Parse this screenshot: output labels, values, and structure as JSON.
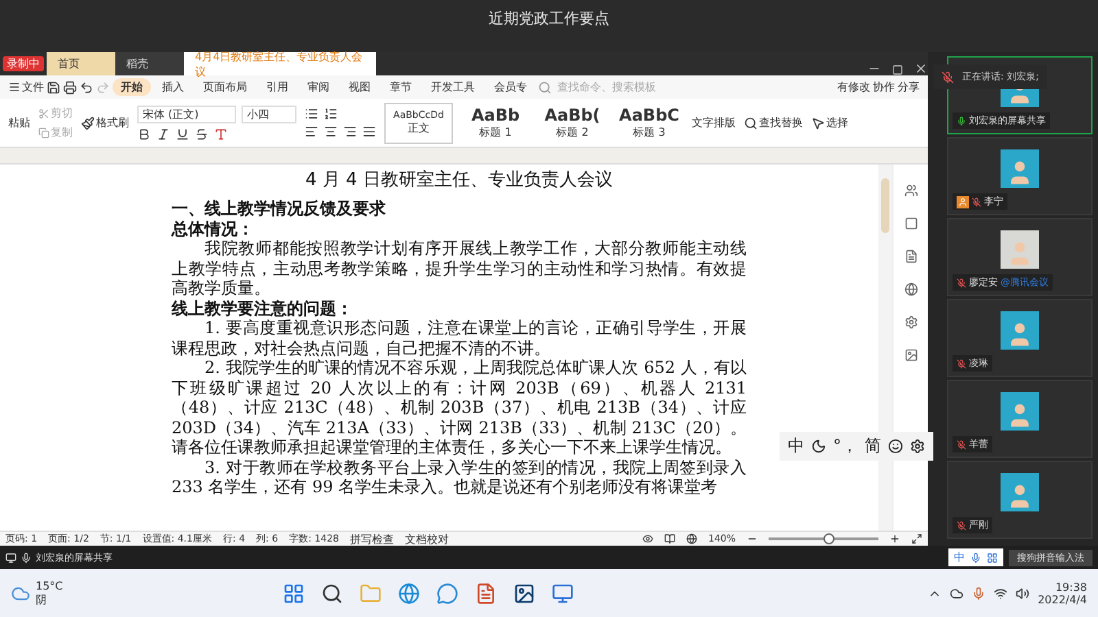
{
  "window": {
    "title": "近期党政工作要点"
  },
  "recording_badge": "录制中",
  "doc_tabs": [
    {
      "label": "首页",
      "selected": false
    },
    {
      "label": "稻壳",
      "selected": false
    },
    {
      "label": "4月4日教研室主任、专业负责人会议",
      "selected": true
    }
  ],
  "menu": {
    "file": "文件",
    "tabs": [
      {
        "label": "开始",
        "selected": true
      },
      {
        "label": "插入",
        "selected": false
      },
      {
        "label": "页面布局",
        "selected": false
      },
      {
        "label": "引用",
        "selected": false
      },
      {
        "label": "审阅",
        "selected": false
      },
      {
        "label": "视图",
        "selected": false
      },
      {
        "label": "章节",
        "selected": false
      },
      {
        "label": "开发工具",
        "selected": false
      },
      {
        "label": "会员专",
        "selected": false
      }
    ],
    "search": {
      "placeholder": "查找命令、搜索模板"
    },
    "actions": [
      "有修改",
      "协作",
      "分享"
    ]
  },
  "toolbar": {
    "paste": "粘贴",
    "cut": "剪切",
    "copy": "复制",
    "format_painter": "格式刷",
    "font": "宋体 (正文)",
    "size": "小四",
    "styles": [
      {
        "sample": "AaBbCcDd",
        "name": "正文"
      },
      {
        "sample": "AaBb",
        "name": "标题 1"
      },
      {
        "sample": "AaBb(",
        "name": "标题 2"
      },
      {
        "sample": "AaBbC",
        "name": "标题 3"
      }
    ],
    "layout": "文字排版",
    "find": "查找替换",
    "select": "选择"
  },
  "document": {
    "title": "4 月 4 日教研室主任、专业负责人会议",
    "blocks": [
      {
        "kind": "heading",
        "text": "一、线上教学情况反馈及要求"
      },
      {
        "kind": "subheading",
        "text": "总体情况："
      },
      {
        "kind": "paragraph",
        "text": "我院教师都能按照教学计划有序开展线上教学工作，大部分教师能主动线上教学特点，主动思考教学策略，提升学生学习的主动性和学习热情。有效提高教学质量。"
      },
      {
        "kind": "subheading",
        "text": "线上教学要注意的问题："
      },
      {
        "kind": "paragraph",
        "text": "1.  要高度重视意识形态问题，注意在课堂上的言论，正确引导学生，开展课程思政，对社会热点问题，自己把握不清的不讲。"
      },
      {
        "kind": "paragraph",
        "text": "2.  我院学生的旷课的情况不容乐观，上周我院总体旷课人次 652 人，有以下班级旷课超过 20 人次以上的有：计网 203B（69）、机器人 2131（48）、计应 213C（48）、机制 203B（37）、机电 213B（34）、计应 203D（34）、汽车 213A（33）、计网 213B（33）、机制 213C（20）。请各位任课教师承担起课堂管理的主体责任，多关心一下不来上课学生情况。"
      },
      {
        "kind": "paragraph",
        "text": "3.  对于教师在学校教务平台上录入学生的签到的情况，我院上周签到录入 233 名学生，还有 99 名学生未录入。也就是说还有个别老师没有将课堂考"
      }
    ]
  },
  "ime_bar": {
    "mode": "中",
    "punct": "°，",
    "script": "简"
  },
  "status_bar": {
    "items": [
      "页码: 1",
      "页面: 1/2",
      "节: 1/1",
      "设置值: 4.1厘米",
      "行: 4",
      "列: 6",
      "字数: 1428"
    ],
    "spell": "拼写检查",
    "proof": "文档校对",
    "zoom": "140%",
    "zoom_level": {
      "level": 0.55
    }
  },
  "speaking": "正在讲话: 刘宏泉;",
  "participants": [
    {
      "name": "刘宏泉的屏幕共享",
      "selected": true,
      "muted": false,
      "host": false
    },
    {
      "name": "李宁",
      "selected": false,
      "muted": true,
      "host": true
    },
    {
      "name": "廖定安",
      "tag": "@腾讯会议",
      "selected": false,
      "muted": true,
      "host": false
    },
    {
      "name": "凌琳",
      "selected": false,
      "muted": true,
      "host": false
    },
    {
      "name": "羊蕾",
      "selected": false,
      "muted": true,
      "host": false
    },
    {
      "name": "严刚",
      "selected": false,
      "muted": true,
      "host": false
    }
  ],
  "share_strip": {
    "label": "刘宏泉的屏幕共享",
    "ime": "中",
    "ime_name": "搜狗拼音输入法"
  },
  "taskbar": {
    "temperature": "15°C",
    "weather": "阴",
    "time": "19:38",
    "date": "2022/4/4"
  }
}
